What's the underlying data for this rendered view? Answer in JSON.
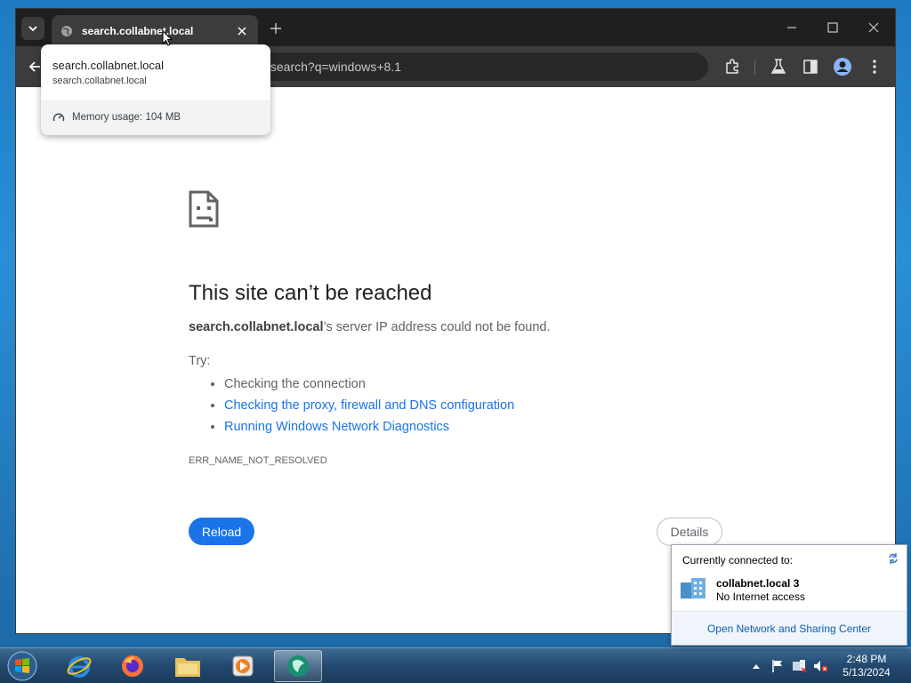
{
  "browser": {
    "tab_title": "search.collabnet.local",
    "url_visible": "/search?q=windows+8.1"
  },
  "hovercard": {
    "title": "search.collabnet.local",
    "url": "search.collabnet.local",
    "memory": "Memory usage: 104 MB"
  },
  "error": {
    "heading": "This site can’t be reached",
    "host": "search.collabnet.local",
    "desc_suffix": "’s server IP address could not be found.",
    "try_label": "Try:",
    "suggestions": [
      "Checking the connection",
      "Checking the proxy, firewall and DNS configuration",
      "Running Windows Network Diagnostics"
    ],
    "code": "ERR_NAME_NOT_RESOLVED",
    "reload_label": "Reload",
    "details_label": "Details"
  },
  "network_popup": {
    "header": "Currently connected to:",
    "network_name": "collabnet.local  3",
    "status": "No Internet access",
    "link": "Open Network and Sharing Center"
  },
  "taskbar": {
    "time": "2:48 PM",
    "date": "5/13/2024"
  },
  "colors": {
    "link_blue": "#1a73e8",
    "tab_dark": "#1f1f1f",
    "toolbar": "#3c3c3c"
  }
}
